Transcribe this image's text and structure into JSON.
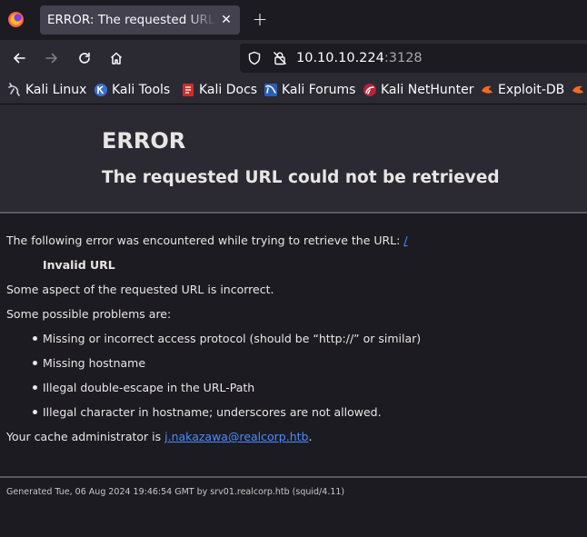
{
  "browser": {
    "tab": {
      "title": "ERROR: The requested URL could not be retrieved",
      "close": "✕"
    },
    "new_tab": "+",
    "url": {
      "host": "10.10.10.224",
      "port": ":3128"
    },
    "bookmarks": [
      {
        "label": "Kali Linux",
        "icon": "kali-dragon-icon"
      },
      {
        "label": "Kali Tools",
        "icon": "kali-tools-icon"
      },
      {
        "label": "Kali Docs",
        "icon": "kali-docs-icon"
      },
      {
        "label": "Kali Forums",
        "icon": "kali-forums-icon"
      },
      {
        "label": "Kali NetHunter",
        "icon": "kali-nethunter-icon"
      },
      {
        "label": "Exploit-DB",
        "icon": "exploit-db-icon"
      }
    ]
  },
  "page": {
    "title": "ERROR",
    "subtitle": "The requested URL could not be retrieved",
    "intro": "The following error was encountered while trying to retrieve the URL:",
    "intro_link": "/",
    "error_name": "Invalid URL",
    "explanation": "Some aspect of the requested URL is incorrect.",
    "problems_heading": "Some possible problems are:",
    "problems": [
      "Missing or incorrect access protocol (should be “http://” or similar)",
      "Missing hostname",
      "Illegal double-escape in the URL-Path",
      "Illegal character in hostname; underscores are not allowed."
    ],
    "admin_prefix": "Your cache administrator is",
    "admin_email": "j.nakazawa@realcorp.htb",
    "admin_suffix": ".",
    "footer": "Generated Tue, 06 Aug 2024 19:46:54 GMT by srv01.realcorp.htb (squid/4.11)"
  },
  "colors": {
    "page_bg": "#1c1b22",
    "header_bg": "#2b2a33",
    "text": "#e8e6e3",
    "link": "#4a8cff"
  }
}
